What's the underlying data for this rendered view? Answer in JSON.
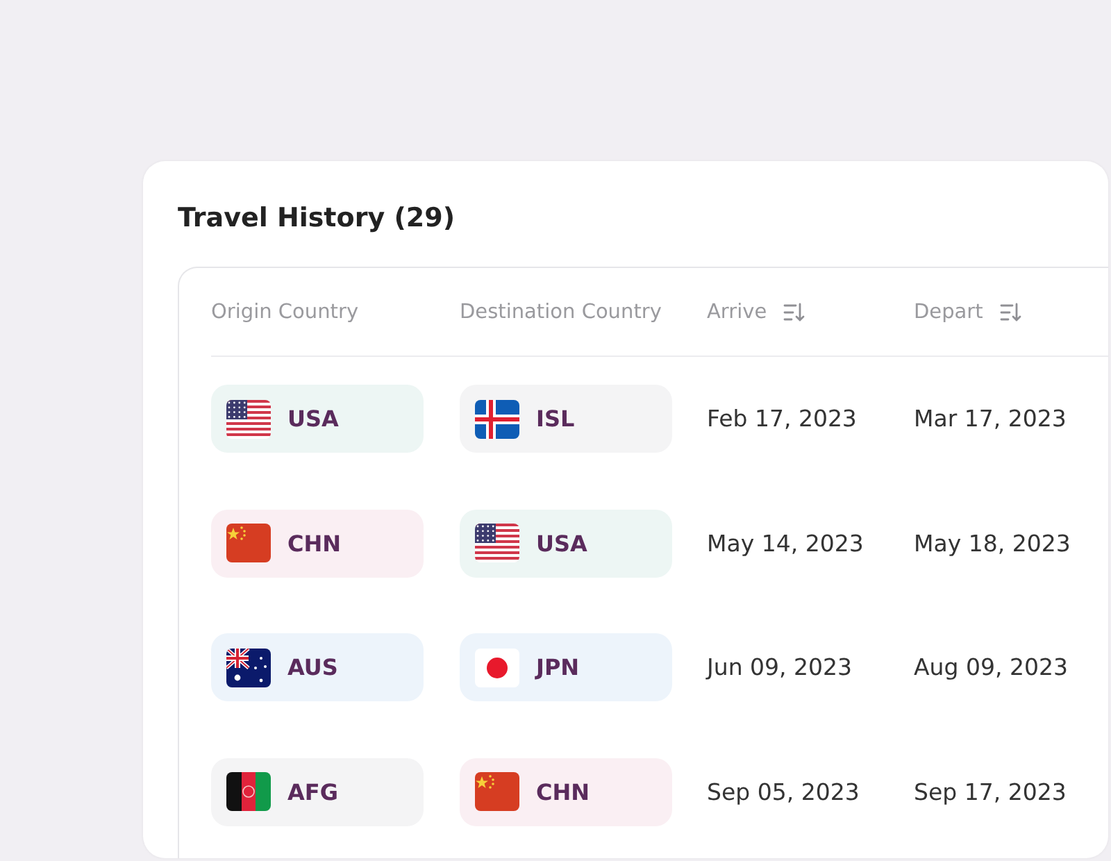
{
  "title": "Travel History (29)",
  "columns": [
    {
      "label": "Origin Country",
      "sortable": false
    },
    {
      "label": "Destination Country",
      "sortable": false
    },
    {
      "label": "Arrive",
      "sortable": true
    },
    {
      "label": "Depart",
      "sortable": true
    }
  ],
  "rows": [
    {
      "origin": {
        "code": "USA",
        "kind": "usa",
        "color": "#edf6f4"
      },
      "destination": {
        "code": "ISL",
        "kind": "isl",
        "color": "#f4f4f5"
      },
      "arrive": "Feb 17, 2023",
      "depart": "Mar 17, 2023"
    },
    {
      "origin": {
        "code": "CHN",
        "kind": "chn",
        "color": "#faeff3"
      },
      "destination": {
        "code": "USA",
        "kind": "usa",
        "color": "#edf6f4"
      },
      "arrive": "May 14, 2023",
      "depart": "May 18, 2023"
    },
    {
      "origin": {
        "code": "AUS",
        "kind": "aus",
        "color": "#edf4fb"
      },
      "destination": {
        "code": "JPN",
        "kind": "jpn",
        "color": "#edf4fb"
      },
      "arrive": "Jun 09, 2023",
      "depart": "Aug 09, 2023"
    },
    {
      "origin": {
        "code": "AFG",
        "kind": "afg",
        "color": "#f4f4f5"
      },
      "destination": {
        "code": "CHN",
        "kind": "chn",
        "color": "#faeff3"
      },
      "arrive": "Sep 05, 2023",
      "depart": "Sep 17, 2023"
    }
  ]
}
